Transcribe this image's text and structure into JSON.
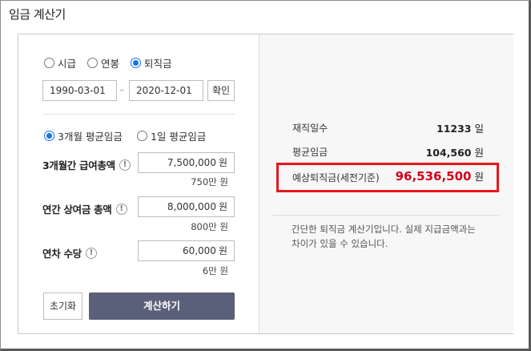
{
  "window": {
    "title": "임금 계산기"
  },
  "calc_type": {
    "options": [
      {
        "label": "시급",
        "checked": false
      },
      {
        "label": "연봉",
        "checked": false
      },
      {
        "label": "퇴직금",
        "checked": true
      }
    ]
  },
  "dates": {
    "start": "1990-03-01",
    "separator": "–",
    "end": "2020-12-01",
    "confirm_label": "확인"
  },
  "avg_type": {
    "options": [
      {
        "label": "3개월 평균임금",
        "checked": true
      },
      {
        "label": "1일 평균임금",
        "checked": false
      }
    ]
  },
  "fields": {
    "pay3m": {
      "label": "3개월간 급여총액",
      "value": "7,500,000",
      "unit": "원",
      "hint": "750만 원"
    },
    "bonus": {
      "label": "연간 상여금 총액",
      "value": "8,000,000",
      "unit": "원",
      "hint": "800만 원"
    },
    "leave": {
      "label": "연차 수당",
      "value": "60,000",
      "unit": "원",
      "hint": "6만 원"
    }
  },
  "info_icon": "!",
  "buttons": {
    "reset_label": "초기화",
    "calc_label": "계산하기"
  },
  "results": {
    "days": {
      "label": "재직일수",
      "value": "11233",
      "unit": "일"
    },
    "avg_wage": {
      "label": "평균임금",
      "value": "104,560",
      "unit": "원"
    },
    "severance": {
      "label": "예상퇴직금(세전기준)",
      "value": "96,536,500",
      "unit": "원"
    }
  },
  "note": "간단한 퇴직금 계산기입니다. 실제 지급금액과는 차이가 있을 수 있습니다.",
  "colors": {
    "accent": "#1a73e8",
    "button": "#5a6079",
    "highlight": "#e8161b",
    "result": "#d0021b"
  }
}
